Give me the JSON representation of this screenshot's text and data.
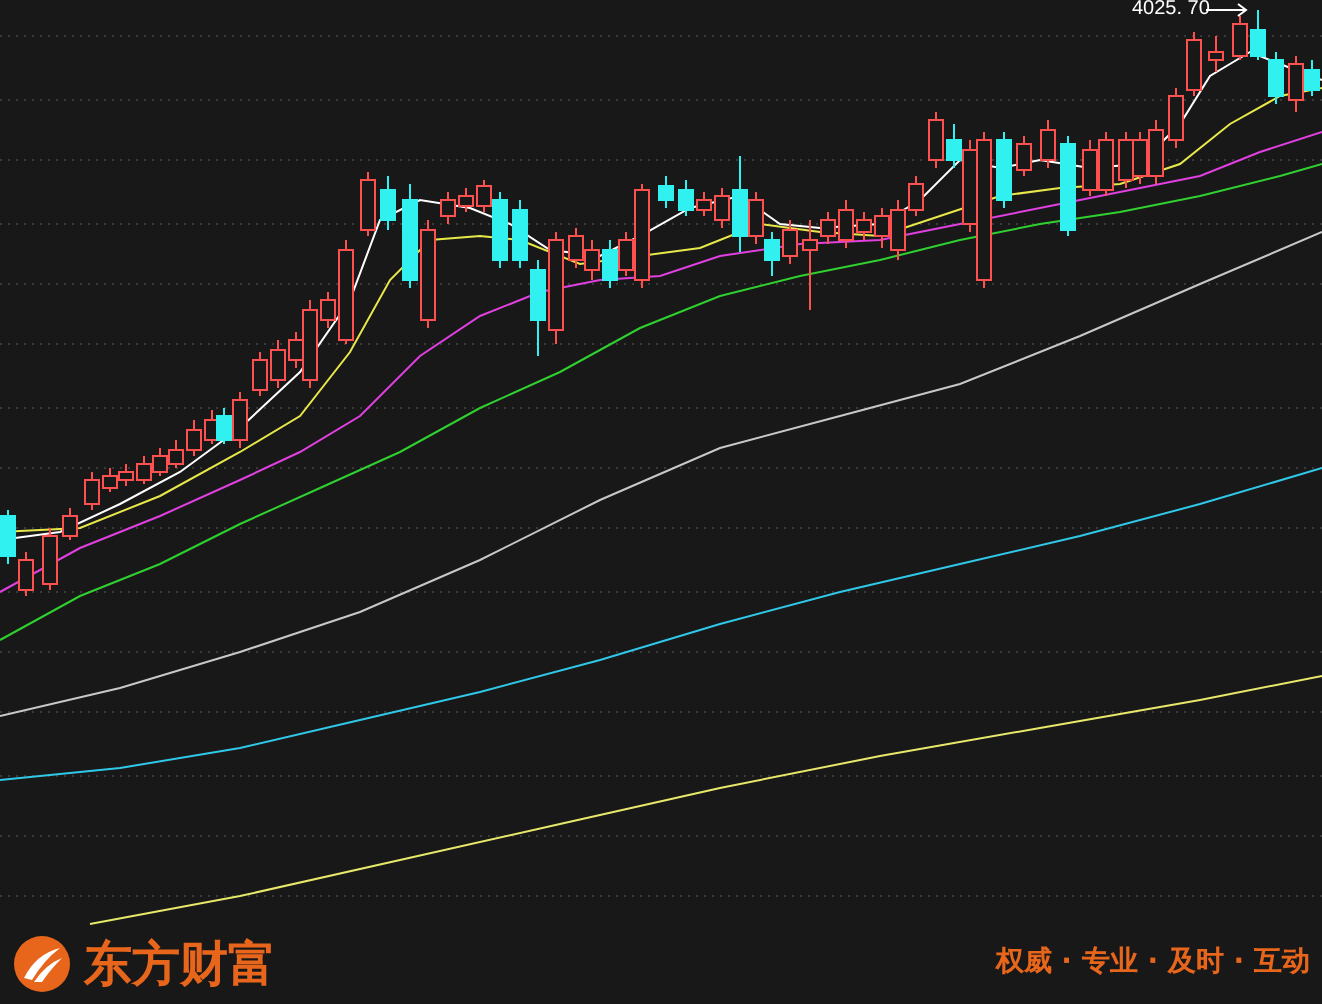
{
  "chart": {
    "high_label": "4025. 70"
  },
  "brand": {
    "name": "东方财富",
    "slogan": "权威 · 专业 · 及时 · 互动"
  }
}
